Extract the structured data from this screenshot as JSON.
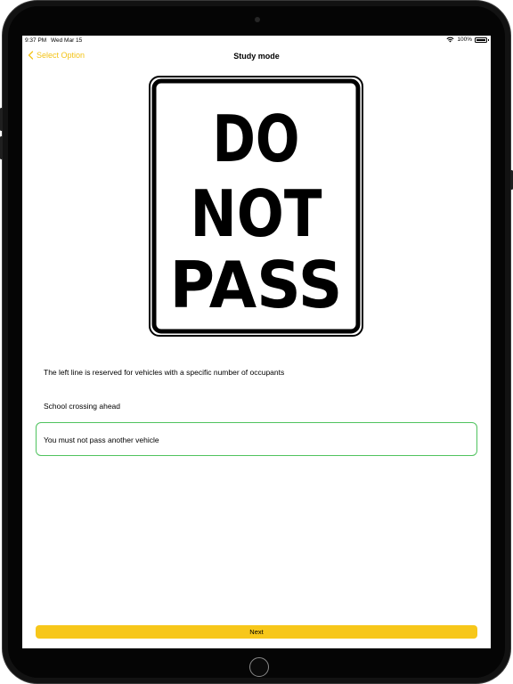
{
  "status_bar": {
    "time": "9:37 PM",
    "date": "Wed Mar 15",
    "battery": "100%"
  },
  "nav": {
    "back_label": "Select Option",
    "title": "Study mode"
  },
  "sign": {
    "lines": [
      "DO",
      "NOT",
      "PASS"
    ]
  },
  "options": [
    {
      "label": "The left line is reserved for vehicles with a specific number of occupants",
      "state": "none"
    },
    {
      "label": "School crossing ahead",
      "state": "none"
    },
    {
      "label": "You must not pass another vehicle",
      "state": "correct"
    }
  ],
  "next_label": "Next",
  "colors": {
    "accent": "#f3c317",
    "next_button": "#f7c71a",
    "correct_border": "#4fc35e"
  }
}
